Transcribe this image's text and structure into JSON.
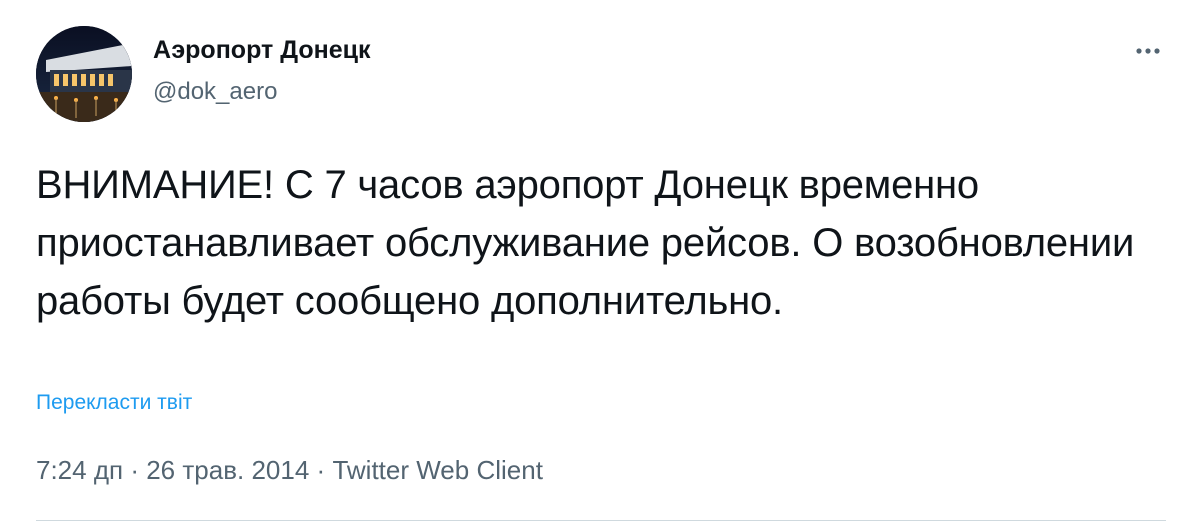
{
  "author": {
    "display_name": "Аэропорт Донецк",
    "handle": "@dok_aero",
    "avatar_icon": "airport-terminal-photo"
  },
  "menu": {
    "icon": "more-horizontal-icon"
  },
  "tweet": {
    "text": "ВНИМАНИЕ! С 7 часов аэропорт Донецк временно приостанавливает обслуживание рейсов. О возобновлении работы будет сообщено дополнительно.",
    "translate_label": "Перекласти твіт",
    "time": "7:24 дп",
    "separator": "·",
    "date": "26 трав. 2014",
    "source": "Twitter Web Client"
  },
  "colors": {
    "text": "#0f1419",
    "secondary": "#536471",
    "link": "#1d9bf0",
    "divider": "#cfd9de"
  }
}
